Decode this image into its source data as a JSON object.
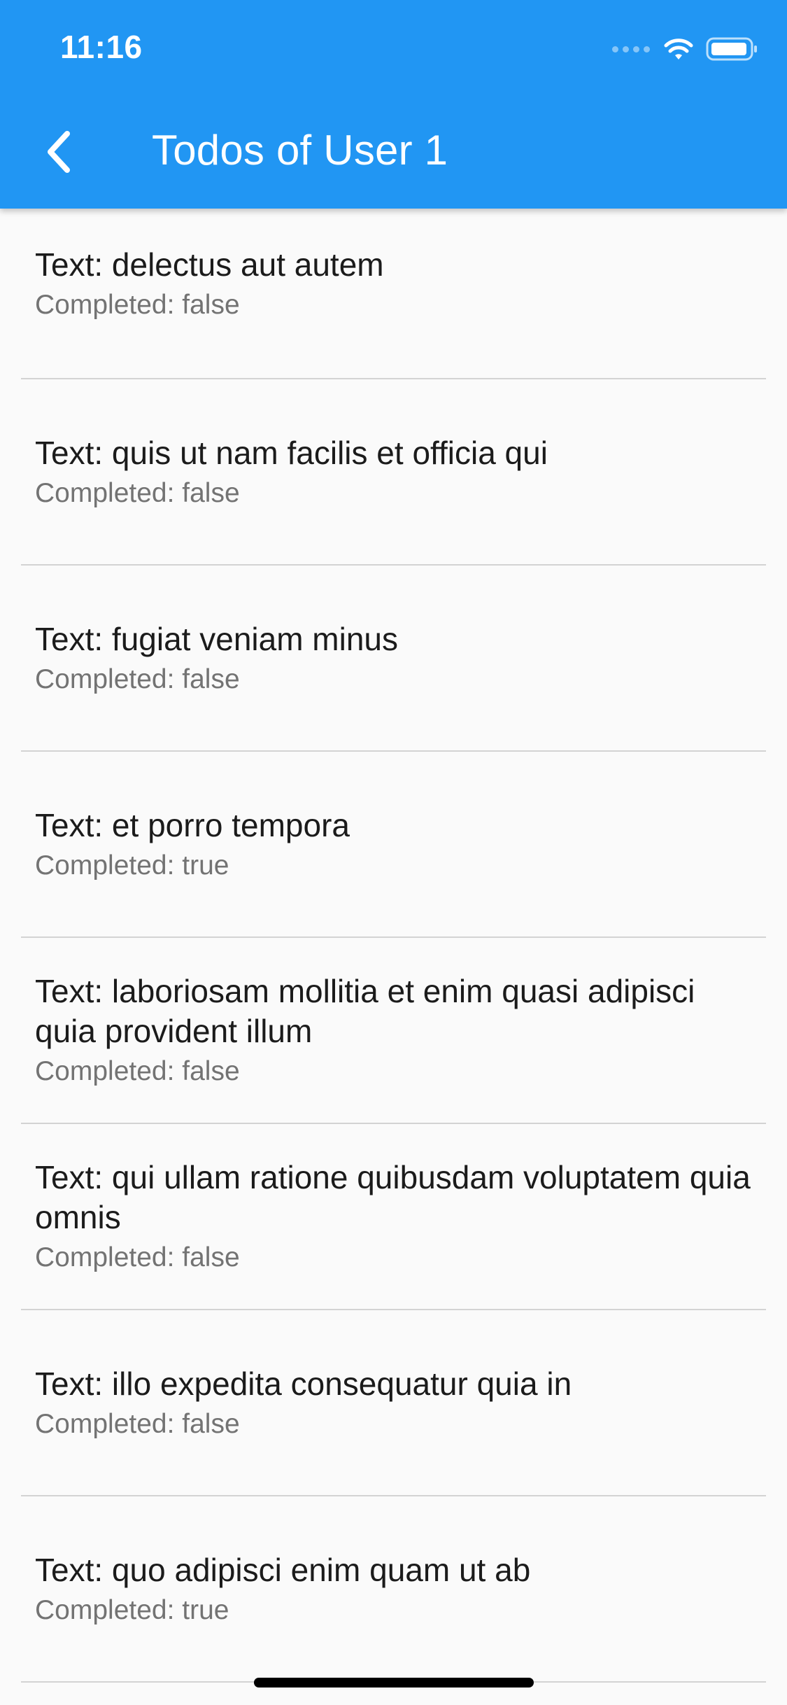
{
  "colors": {
    "app_bar": "#2196f3",
    "background": "#fafafa",
    "title_text": "#1b1b1b",
    "subtitle_text": "#737373",
    "divider": "#d3d3d3"
  },
  "status_bar": {
    "time": "11:16",
    "icons": [
      "cellular-signal-icon",
      "wifi-icon",
      "battery-icon"
    ]
  },
  "app_bar": {
    "back_icon": "chevron-left-icon",
    "title": "Todos of User 1"
  },
  "todos": [
    {
      "text": "Text: delectus aut autem",
      "status": "Completed: false"
    },
    {
      "text": "Text: quis ut nam facilis et officia qui",
      "status": "Completed: false"
    },
    {
      "text": "Text: fugiat veniam minus",
      "status": "Completed: false"
    },
    {
      "text": "Text: et porro tempora",
      "status": "Completed: true"
    },
    {
      "text": "Text: laboriosam mollitia et enim quasi adipisci quia provident illum",
      "status": "Completed: false"
    },
    {
      "text": "Text: qui ullam ratione quibusdam voluptatem quia omnis",
      "status": "Completed: false"
    },
    {
      "text": "Text: illo expedita consequatur quia in",
      "status": "Completed: false"
    },
    {
      "text": "Text: quo adipisci enim quam ut ab",
      "status": "Completed: true"
    }
  ]
}
